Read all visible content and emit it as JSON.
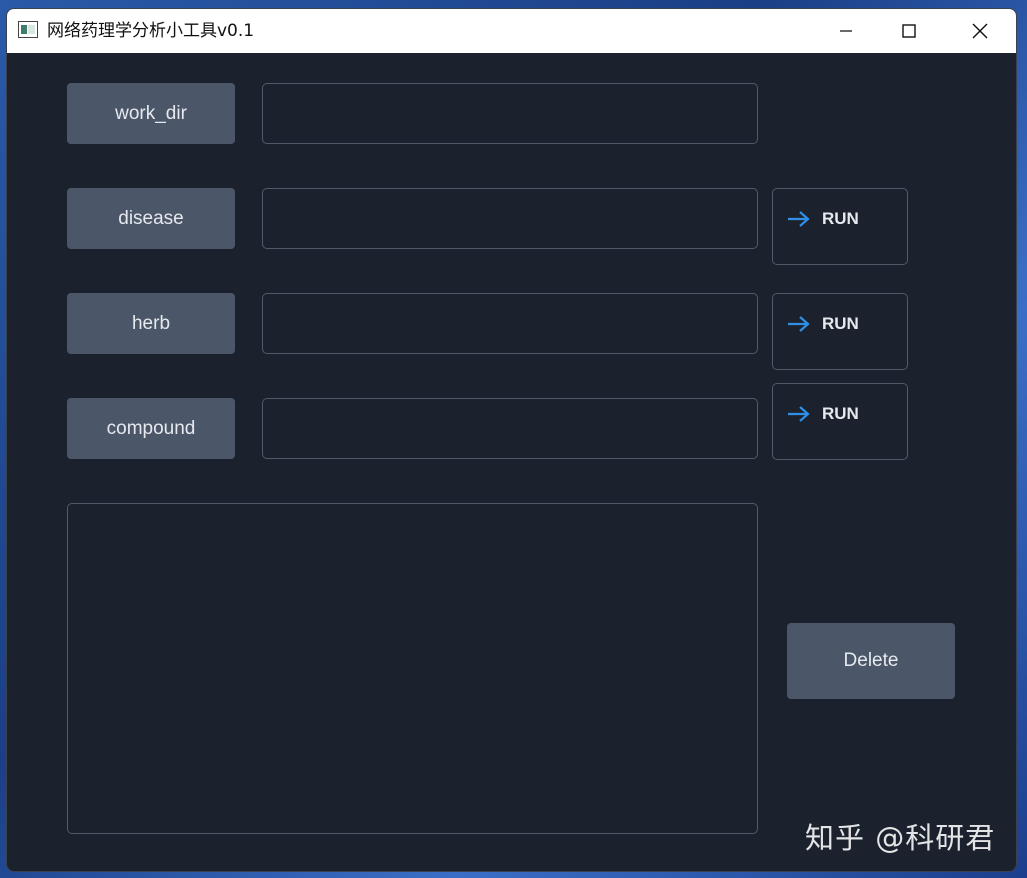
{
  "window": {
    "title": "网络药理学分析小工具v0.1"
  },
  "rows": [
    {
      "label": "work_dir",
      "value": ""
    },
    {
      "label": "disease",
      "value": "",
      "run_label": "RUN"
    },
    {
      "label": "herb",
      "value": "",
      "run_label": "RUN"
    },
    {
      "label": "compound",
      "value": "",
      "run_label": "RUN"
    }
  ],
  "delete_label": "Delete",
  "watermark": "知乎 @科研君",
  "colors": {
    "window_bg": "#1b222d",
    "button_bg": "#4b5668",
    "border": "#505a6b",
    "accent_arrow": "#2f8ee6",
    "text": "#e6e9ee"
  },
  "icons": {
    "app": "app-window-icon",
    "minimize": "minimize-icon",
    "maximize": "maximize-icon",
    "close": "close-icon",
    "run": "arrow-right-icon"
  }
}
